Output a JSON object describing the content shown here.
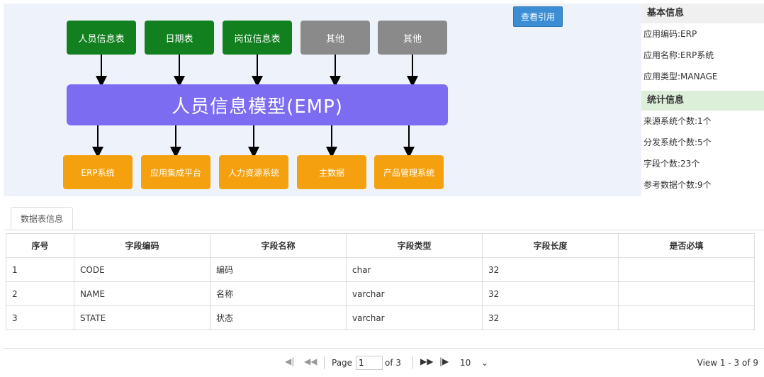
{
  "diagram": {
    "sources": [
      {
        "label": "人员信息表",
        "color": "green"
      },
      {
        "label": "日期表",
        "color": "green"
      },
      {
        "label": "岗位信息表",
        "color": "green"
      },
      {
        "label": "其他",
        "color": "gray"
      },
      {
        "label": "其他",
        "color": "gray"
      }
    ],
    "model_label": "人员信息模型(EMP)",
    "targets": [
      "ERP系统",
      "应用集成平台",
      "人力资源系统",
      "主数据",
      "产品管理系统"
    ]
  },
  "toolbar": {
    "quote_button": "查看引用"
  },
  "info_panel": {
    "basic_title": "基本信息",
    "basic_rows": [
      "应用编码:ERP",
      "应用名称:ERP系统",
      "应用类型:MANAGE"
    ],
    "stats_title": "统计信息",
    "stats_rows": [
      "来源系统个数:1个",
      "分发系统个数:5个",
      "字段个数:23个",
      "参考数据个数:9个"
    ]
  },
  "tabs": {
    "active": "数据表信息"
  },
  "table": {
    "headers": [
      "序号",
      "字段编码",
      "字段名称",
      "字段类型",
      "字段长度",
      "是否必填"
    ],
    "rows": [
      [
        "1",
        "CODE",
        "编码",
        "char",
        "32",
        ""
      ],
      [
        "2",
        "NAME",
        "名称",
        "varchar",
        "32",
        ""
      ],
      [
        "3",
        "STATE",
        "状态",
        "varchar",
        "32",
        ""
      ]
    ]
  },
  "pager": {
    "page_label": "Page",
    "page_value": "1",
    "of_label": "of 3",
    "page_size": "10",
    "view_text": "View 1 - 3 of 9"
  },
  "colors": {
    "source_green": "#12801f",
    "source_gray": "#8a8a8a",
    "model_purple": "#7b6cf2",
    "target_orange": "#f5a10f",
    "button_blue": "#3b8ed4",
    "stats_header_green": "#dcefd8"
  }
}
